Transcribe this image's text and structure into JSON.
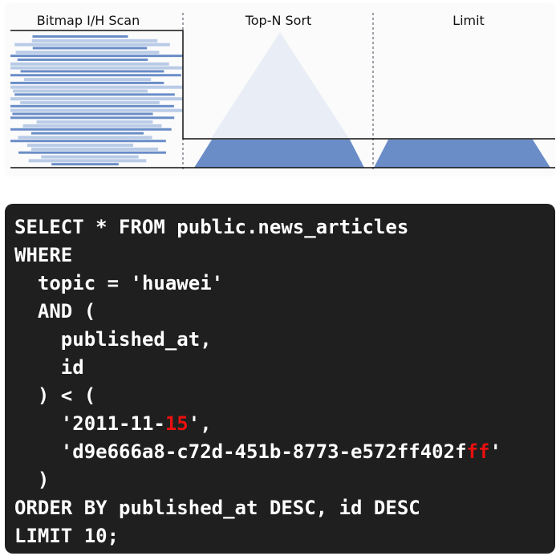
{
  "diagram": {
    "stages": [
      {
        "label": "Bitmap I/H Scan"
      },
      {
        "label": "Top-N Sort"
      },
      {
        "label": "Limit"
      }
    ],
    "colors": {
      "row_dark": "#6a8dc7",
      "row_light": "#b9cbe6",
      "triangle_faint": "#e9edf6",
      "triangle_fill": "#6a8dc7",
      "line": "#111111"
    }
  },
  "query": {
    "lines": [
      {
        "parts": [
          {
            "text": "SELECT * FROM public.news_articles"
          }
        ]
      },
      {
        "parts": [
          {
            "text": "WHERE"
          }
        ]
      },
      {
        "parts": [
          {
            "text": "  topic = 'huawei'"
          }
        ]
      },
      {
        "parts": [
          {
            "text": "  AND ("
          }
        ]
      },
      {
        "parts": [
          {
            "text": "    published_at,"
          }
        ]
      },
      {
        "parts": [
          {
            "text": "    id"
          }
        ]
      },
      {
        "parts": [
          {
            "text": "  ) < ("
          }
        ]
      },
      {
        "parts": [
          {
            "text": "    '2011-11-"
          },
          {
            "text": "15",
            "highlight": true
          },
          {
            "text": "',"
          }
        ]
      },
      {
        "parts": [
          {
            "text": "    'd9e666a8-c72d-451b-8773-e572ff402f"
          },
          {
            "text": "ff",
            "highlight": true
          },
          {
            "text": "'"
          }
        ]
      },
      {
        "parts": [
          {
            "text": "  )"
          }
        ]
      },
      {
        "parts": [
          {
            "text": "ORDER BY published_at DESC, id DESC"
          }
        ]
      },
      {
        "parts": [
          {
            "text": "LIMIT 10;"
          }
        ]
      }
    ],
    "colors": {
      "background": "#1f1f1f",
      "text": "#ffffff",
      "highlight": "#e8100f"
    }
  }
}
